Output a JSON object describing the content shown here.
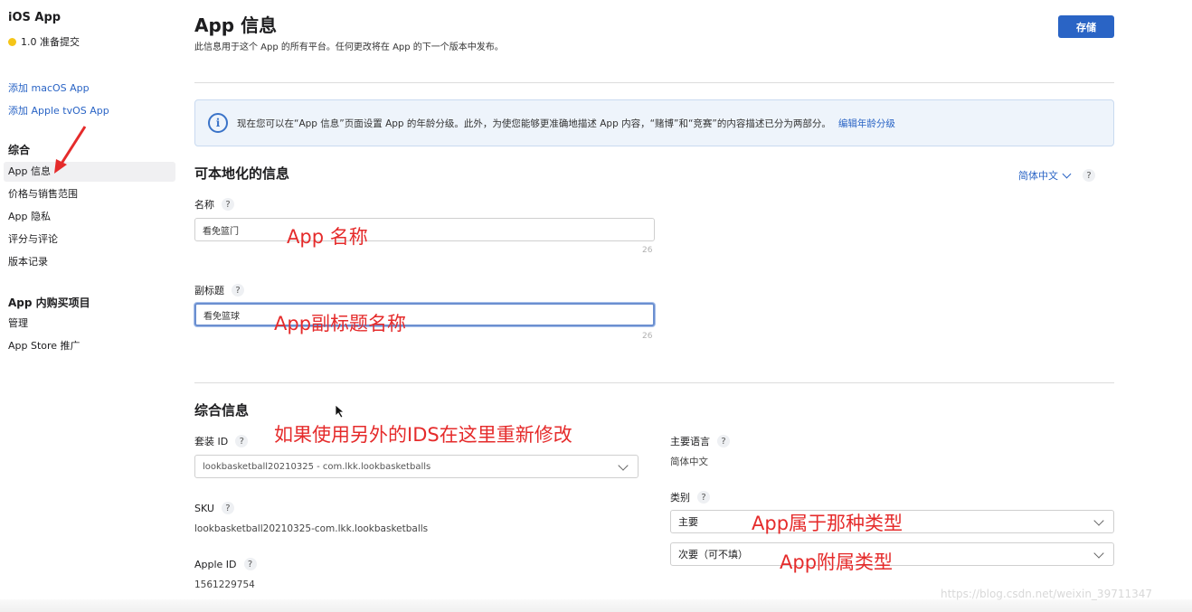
{
  "sidebar": {
    "app_title": "iOS App",
    "version_status": "1.0 准备提交",
    "links": [
      "添加 macOS App",
      "添加 Apple tvOS App"
    ],
    "section_general": "综合",
    "general_items": [
      "App 信息",
      "价格与销售范围",
      "App 隐私",
      "评分与评论",
      "版本记录"
    ],
    "section_iap": "App 内购买项目",
    "iap_items": [
      "管理",
      "App Store 推广"
    ]
  },
  "header": {
    "title": "App 信息",
    "subtitle": "此信息用于这个 App 的所有平台。任何更改将在 App 的下一个版本中发布。",
    "save_label": "存储"
  },
  "banner": {
    "text": "现在您可以在“App 信息”页面设置 App 的年龄分级。此外，为使您能够更准确地描述 App 内容，“赌博”和“竞赛”的内容描述已分为两部分。",
    "link": "编辑年龄分级"
  },
  "localizable": {
    "title": "可本地化的信息",
    "language": "简体中文",
    "name_label": "名称",
    "name_value": "看免篮门",
    "name_counter": "26",
    "subtitle_label": "副标题",
    "subtitle_value": "看免篮球",
    "subtitle_counter": "26"
  },
  "general": {
    "title": "综合信息",
    "bundle_label": "套装 ID",
    "bundle_value": "lookbasketball20210325 - com.lkk.lookbasketballs",
    "sku_label": "SKU",
    "sku_value": "lookbasketball20210325-com.lkk.lookbasketballs",
    "apple_id_label": "Apple ID",
    "apple_id_value": "1561229754",
    "primary_lang_label": "主要语言",
    "primary_lang_value": "简体中文",
    "category_label": "类别",
    "primary_category": "主要",
    "secondary_category": "次要（可不填）"
  },
  "annotations": {
    "name": "App 名称",
    "subtitle": "App副标题名称",
    "ids": "如果使用另外的IDS在这里重新修改",
    "category_primary": "App属于那种类型",
    "category_secondary": "App附属类型"
  },
  "watermark": "https://blog.csdn.net/weixin_39711347",
  "colors": {
    "accent": "#2a64c5",
    "annotation_red": "#e52b2b",
    "status_yellow": "#f5c518"
  }
}
